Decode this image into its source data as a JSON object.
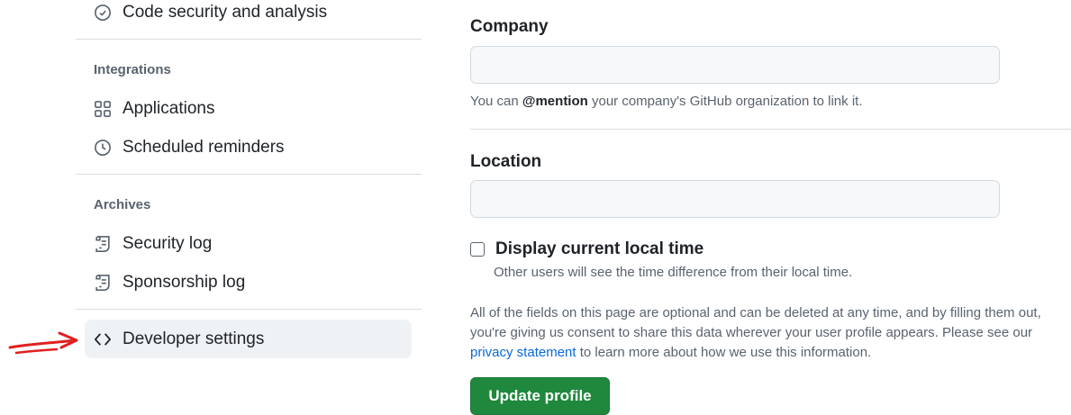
{
  "sidebar": {
    "top_item": {
      "label": "Code security and analysis",
      "icon": "shield-icon"
    },
    "integrations": {
      "heading": "Integrations",
      "items": [
        {
          "label": "Applications",
          "icon": "apps-grid-icon"
        },
        {
          "label": "Scheduled reminders",
          "icon": "clock-icon"
        }
      ]
    },
    "archives": {
      "heading": "Archives",
      "items": [
        {
          "label": "Security log",
          "icon": "log-icon"
        },
        {
          "label": "Sponsorship log",
          "icon": "log-icon"
        }
      ]
    },
    "developer": {
      "label": "Developer settings",
      "icon": "code-icon",
      "selected": true
    }
  },
  "form": {
    "company": {
      "label": "Company",
      "value": "",
      "hint_prefix": "You can ",
      "hint_mention": "@mention",
      "hint_suffix": " your company's GitHub organization to link it."
    },
    "location": {
      "label": "Location",
      "value": ""
    },
    "local_time": {
      "label": "Display current local time",
      "checked": false,
      "note": "Other users will see the time difference from their local time."
    },
    "disclaimer": {
      "text_before": "All of the fields on this page are optional and can be deleted at any time, and by filling them out, you're giving us consent to share this data wherever your user profile appears. Please see our ",
      "link": "privacy statement",
      "text_after": " to learn more about how we use this information."
    },
    "submit_label": "Update profile"
  },
  "colors": {
    "accent_green": "#1f883d",
    "link_blue": "#0969da",
    "annotation_red": "#e02020"
  }
}
